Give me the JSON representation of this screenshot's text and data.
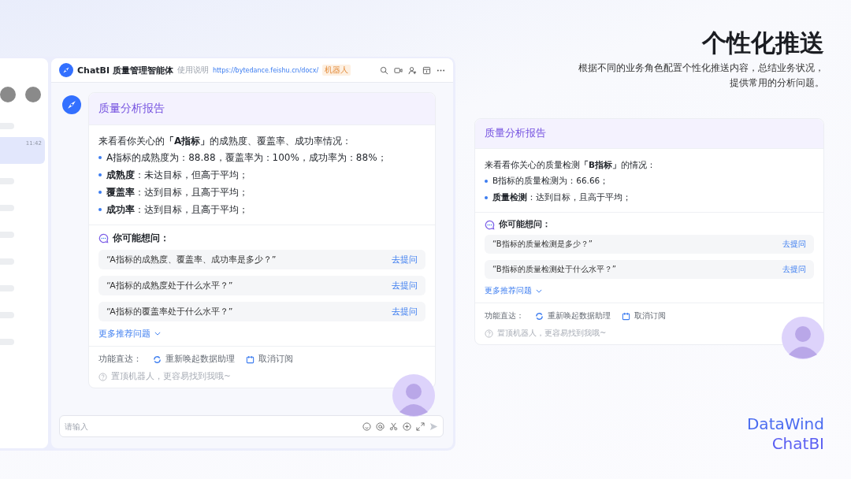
{
  "slide": {
    "title": "个性化推送",
    "subtitle_lines": [
      "根据不同的业务角色配置个性化推送内容，总结业务状况，",
      "提供常用的分析问题。"
    ]
  },
  "chat_app": {
    "sidebar": {
      "items": [
        {
          "selected": false
        },
        {
          "selected": true,
          "time": "11:42"
        },
        {
          "selected": false
        },
        {
          "selected": false
        },
        {
          "selected": false
        },
        {
          "selected": false
        },
        {
          "selected": false
        },
        {
          "selected": false
        },
        {
          "selected": false
        }
      ]
    },
    "header": {
      "bot_name": "ChatBI 质量管理智能体",
      "help_label": "使用说明",
      "link": "https://bytedance.feishu.cn/docx/",
      "badge": "机器人"
    },
    "report": {
      "title": "质量分析报告",
      "intro": "来看看你关心的**「A指标」**的成熟度、覆盖率、成功率情况：",
      "bullets": [
        "A指标的成熟度为：88.88，覆盖率为：100%，成功率为：88%；",
        "**成熟度**：未达目标，但高于平均；",
        "**覆盖率**：达到目标，且高于平均；",
        "**成功率**：达到目标，且高于平均；"
      ],
      "suggest_label": "你可能想问：",
      "questions": [
        {
          "text": "“A指标的成熟度、覆盖率、成功率是多少？”",
          "action": "去提问"
        },
        {
          "text": "“A指标的成熟度处于什么水平？”",
          "action": "去提问"
        },
        {
          "text": "“A指标的覆盖率处于什么水平？”",
          "action": "去提问"
        }
      ],
      "more": "更多推荐问题",
      "shortcut_label": "功能直达：",
      "shortcuts": [
        {
          "kind": "refresh",
          "label": "重新唤起数据助理"
        },
        {
          "kind": "unsubscribe",
          "label": "取消订阅"
        }
      ],
      "tip": "置顶机器人，更容易找到我哦~"
    },
    "input": {
      "placeholder": "请输入"
    }
  },
  "report_preview": {
    "title": "质量分析报告",
    "intro": "来看看你关心的质量检测**「B指标」**的情况：",
    "bullets": [
      "B指标的质量检测为：66.66；",
      "**质量检测**：达到目标，且高于平均；"
    ],
    "suggest_label": "你可能想问：",
    "questions": [
      {
        "text": "“B指标的质量检测是多少？”",
        "action": "去提问"
      },
      {
        "text": "“B指标的质量检测处于什么水平？”",
        "action": "去提问"
      }
    ],
    "more": "更多推荐问题",
    "shortcut_label": "功能直达：",
    "shortcuts": [
      {
        "kind": "refresh",
        "label": "重新唤起数据助理"
      },
      {
        "kind": "unsubscribe",
        "label": "取消订阅"
      }
    ],
    "tip": "置顶机器人，更容易找到我哦~"
  },
  "brand": {
    "line1": "DataWind",
    "line2": "ChatBI"
  }
}
